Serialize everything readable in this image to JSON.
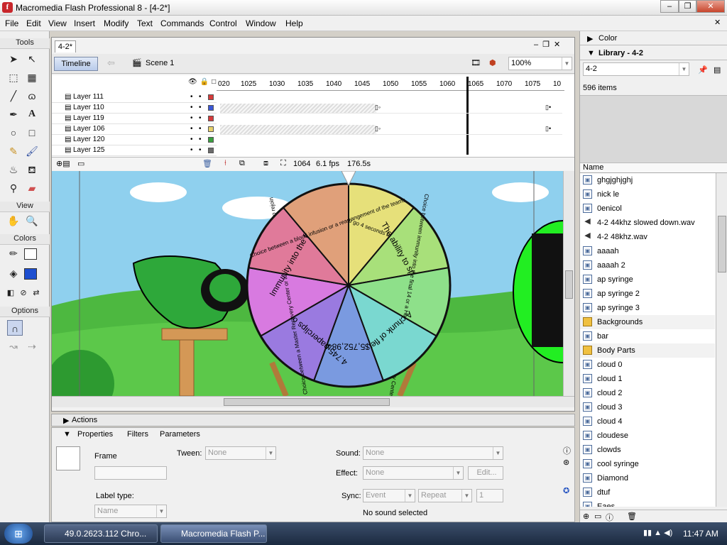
{
  "window": {
    "title": "Macromedia Flash Professional 8 - [4-2*]"
  },
  "menu": [
    "File",
    "Edit",
    "View",
    "Insert",
    "Modify",
    "Text",
    "Commands",
    "Control",
    "Window",
    "Help"
  ],
  "tools": {
    "title": "Tools",
    "view_title": "View",
    "colors_title": "Colors",
    "options_title": "Options"
  },
  "document": {
    "tab": "4-2*",
    "timeline_button": "Timeline",
    "scene": "Scene 1",
    "zoom": "100%",
    "ruler": [
      "020",
      "1025",
      "1030",
      "1035",
      "1040",
      "1045",
      "1050",
      "1055",
      "1060",
      "1065",
      "1070",
      "1075",
      "10"
    ],
    "layers": [
      {
        "name": "Layer 111",
        "color": "#d63a3a"
      },
      {
        "name": "Layer 110",
        "color": "#3a57d6"
      },
      {
        "name": "Layer 119",
        "color": "#d63a3a"
      },
      {
        "name": "Layer 106",
        "color": "#e8d26b"
      },
      {
        "name": "Layer 120",
        "color": "#3aa040"
      },
      {
        "name": "Layer 125",
        "color": "#6b6b6b"
      }
    ],
    "status": {
      "frame": "1064",
      "fps": "6.1 fps",
      "time": "176.5s"
    }
  },
  "wheel": {
    "segments": [
      {
        "text": "A chance to go 4 seconds back in time",
        "color": "#e6e07a"
      },
      {
        "text": "The ability to speak",
        "color": "#a8e07a"
      },
      {
        "text": "Choice between immunity into the final 14 or a Hamster powered Recovery Center",
        "color": "#8ee08a"
      },
      {
        "text": "A chunk of flesh",
        "color": "#7ad8d0"
      },
      {
        "text": "$5,752,984",
        "color": "#7a9ae0"
      },
      {
        "text": "4.745 paperclips or a twig",
        "color": "#9a7ae0"
      },
      {
        "text": "Choice between a Master Recovery Center or an eliminated contestant to rejoin",
        "color": "#d87ae0"
      },
      {
        "text": "Immunity into the final 14",
        "color": "#e07a9a"
      },
      {
        "text": "Choice between a blood infusion or a rearrangement of the teams",
        "color": "#e0a07a"
      }
    ]
  },
  "panels": {
    "actions_label": "Actions",
    "tabs": [
      "Properties",
      "Filters",
      "Parameters"
    ],
    "frame_label": "Frame",
    "label_type": "Label type:",
    "label_type_value": "Name",
    "tween_label": "Tween:",
    "tween_value": "None",
    "sound_label": "Sound:",
    "sound_value": "None",
    "effect_label": "Effect:",
    "effect_value": "None",
    "edit_button": "Edit...",
    "sync_label": "Sync:",
    "sync_value": "Event",
    "repeat_value": "Repeat",
    "repeat_count": "1",
    "sound_status": "No sound selected"
  },
  "library": {
    "color_panel": "Color",
    "title": "Library - 4-2",
    "selected": "4-2",
    "count": "596 items",
    "column": "Name",
    "items": [
      {
        "name": "ghgjghjghj",
        "type": "symbol"
      },
      {
        "name": "nick le",
        "type": "symbol"
      },
      {
        "name": "0enicol",
        "type": "symbol"
      },
      {
        "name": "4-2 44khz slowed down.wav",
        "type": "sound"
      },
      {
        "name": "4-2 48khz.wav",
        "type": "sound"
      },
      {
        "name": "aaaah",
        "type": "symbol"
      },
      {
        "name": "aaaah 2",
        "type": "symbol"
      },
      {
        "name": "ap syringe",
        "type": "symbol"
      },
      {
        "name": "ap syringe 2",
        "type": "symbol"
      },
      {
        "name": "ap syringe 3",
        "type": "symbol"
      },
      {
        "name": "Backgrounds",
        "type": "folder"
      },
      {
        "name": "bar",
        "type": "symbol"
      },
      {
        "name": "Body Parts",
        "type": "folder"
      },
      {
        "name": "cloud 0",
        "type": "symbol"
      },
      {
        "name": "cloud 1",
        "type": "symbol"
      },
      {
        "name": "cloud 2",
        "type": "symbol"
      },
      {
        "name": "cloud 3",
        "type": "symbol"
      },
      {
        "name": "cloud 4",
        "type": "symbol"
      },
      {
        "name": "cloudese",
        "type": "symbol"
      },
      {
        "name": "clowds",
        "type": "symbol"
      },
      {
        "name": "cool syringe",
        "type": "symbol"
      },
      {
        "name": "Diamond",
        "type": "symbol"
      },
      {
        "name": "dtuf",
        "type": "symbol"
      },
      {
        "name": "Eaes",
        "type": "symbol"
      }
    ]
  },
  "taskbar": {
    "items": [
      "49.0.2623.112 Chro...",
      "Macromedia Flash P..."
    ],
    "time": "11:47 AM"
  }
}
